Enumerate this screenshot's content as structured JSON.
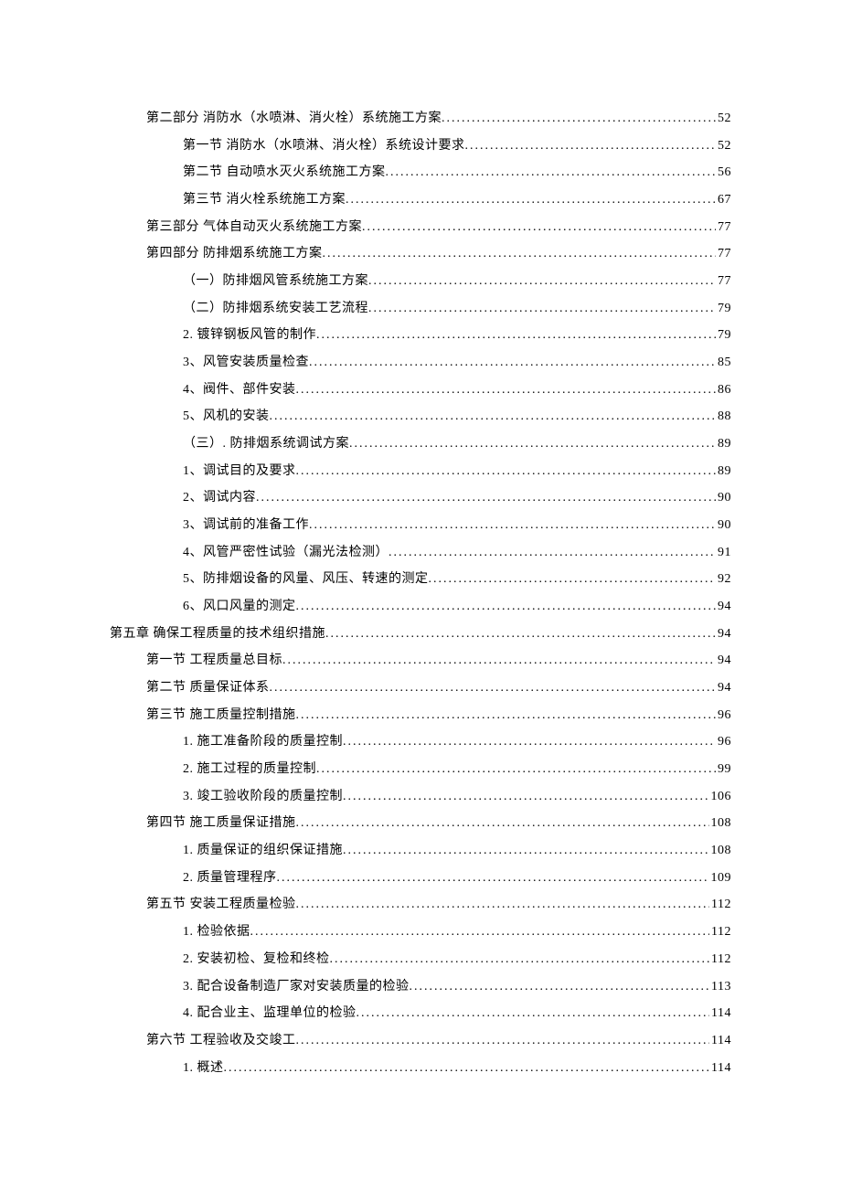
{
  "toc": [
    {
      "level": 1,
      "text": "第二部分 消防水（水喷淋、消火栓）系统施工方案",
      "page": "52"
    },
    {
      "level": 2,
      "text": "第一节  消防水（水喷淋、消火栓）系统设计要求",
      "page": "52"
    },
    {
      "level": 2,
      "text": "第二节  自动喷水灭火系统施工方案",
      "page": "56"
    },
    {
      "level": 2,
      "text": "第三节  消火栓系统施工方案 ",
      "page": "67"
    },
    {
      "level": 1,
      "text": "第三部分  气体自动灭火系统施工方案",
      "page": "77"
    },
    {
      "level": 1,
      "text": "第四部分  防排烟系统施工方案 ",
      "page": "77"
    },
    {
      "level": 2,
      "text": "（一）防排烟风管系统施工方案",
      "page": "77"
    },
    {
      "level": 2,
      "text": "（二）防排烟系统安装工艺流程",
      "page": "79"
    },
    {
      "level": 2,
      "text": "2.  镀锌钢板风管的制作 ",
      "page": "79"
    },
    {
      "level": 2,
      "text": "3、风管安装质量检查 ",
      "page": "85"
    },
    {
      "level": 2,
      "text": "4、阀件、部件安装 ",
      "page": "86"
    },
    {
      "level": 2,
      "text": "5、风机的安装 ",
      "page": "88"
    },
    {
      "level": 2,
      "text": "（三）. 防排烟系统调试方案 ",
      "page": "89"
    },
    {
      "level": 2,
      "text": "1、调试目的及要求 ",
      "page": "89"
    },
    {
      "level": 2,
      "text": "2、调试内容 ",
      "page": "90"
    },
    {
      "level": 2,
      "text": "3、调试前的准备工作 ",
      "page": "90"
    },
    {
      "level": 2,
      "text": "4、风管严密性试验（漏光法检测）",
      "page": "91"
    },
    {
      "level": 2,
      "text": "5、防排烟设备的风量、风压、转速的测定",
      "page": "92"
    },
    {
      "level": 2,
      "text": "6、风口风量的测定 ",
      "page": "94"
    },
    {
      "level": 0,
      "text": "第五章  确保工程质量的技术组织措施 ",
      "page": "94"
    },
    {
      "level": 1,
      "text": "第一节  工程质量总目标 ",
      "page": "94"
    },
    {
      "level": 1,
      "text": "第二节  质量保证体系 ",
      "page": "94"
    },
    {
      "level": 1,
      "text": "第三节  施工质量控制措施 ",
      "page": "96"
    },
    {
      "level": 2,
      "text": "1. 施工准备阶段的质量控制 ",
      "page": "96"
    },
    {
      "level": 2,
      "text": "2. 施工过程的质量控制 ",
      "page": "99"
    },
    {
      "level": 2,
      "text": "3. 竣工验收阶段的质量控制 ",
      "page": "106"
    },
    {
      "level": 1,
      "text": "第四节  施工质量保证措施 ",
      "page": "108"
    },
    {
      "level": 2,
      "text": "1. 质量保证的组织保证措施 ",
      "page": "108"
    },
    {
      "level": 2,
      "text": "2. 质量管理程序 ",
      "page": "109"
    },
    {
      "level": 1,
      "text": "第五节  安装工程质量检验 ",
      "page": "112"
    },
    {
      "level": 2,
      "text": "1. 检验依据 ",
      "page": "112"
    },
    {
      "level": 2,
      "text": "2. 安装初检、复检和终检 ",
      "page": "112"
    },
    {
      "level": 2,
      "text": "3. 配合设备制造厂家对安装质量的检验",
      "page": "113"
    },
    {
      "level": 2,
      "text": "4. 配合业主、监理单位的检验 ",
      "page": "114"
    },
    {
      "level": 1,
      "text": "第六节  工程验收及交竣工 ",
      "page": "114"
    },
    {
      "level": 2,
      "text": "1. 概述 ",
      "page": "114"
    }
  ]
}
